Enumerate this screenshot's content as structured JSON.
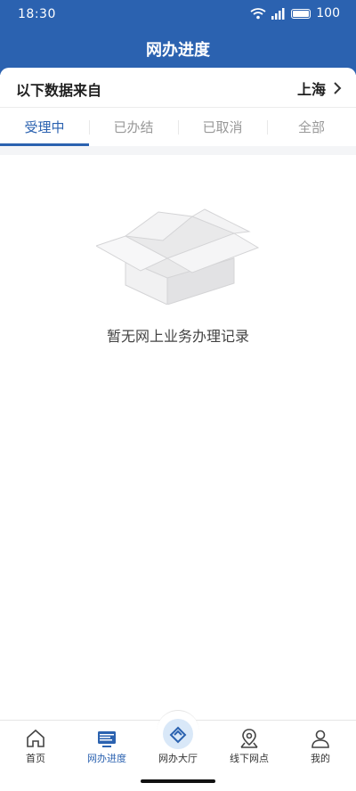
{
  "status_bar": {
    "time": "18:30",
    "battery": "100"
  },
  "header": {
    "title": "网办进度"
  },
  "source": {
    "label": "以下数据来自",
    "city": "上海"
  },
  "tabs": [
    {
      "label": "受理中",
      "active": true
    },
    {
      "label": "已办结",
      "active": false
    },
    {
      "label": "已取消",
      "active": false
    },
    {
      "label": "全部",
      "active": false
    }
  ],
  "empty_state": {
    "message": "暂无网上业务办理记录"
  },
  "bottom_nav": [
    {
      "label": "首页",
      "icon": "home-icon",
      "active": false
    },
    {
      "label": "网办进度",
      "icon": "monitor-icon",
      "active": true
    },
    {
      "label": "网办大厅",
      "icon": "hall-icon",
      "active": false
    },
    {
      "label": "线下网点",
      "icon": "map-pin-icon",
      "active": false
    },
    {
      "label": "我的",
      "icon": "user-icon",
      "active": false
    }
  ],
  "colors": {
    "brand": "#2b62b0",
    "inactive_tab": "#999999",
    "center_highlight": "#d9e8f8"
  }
}
